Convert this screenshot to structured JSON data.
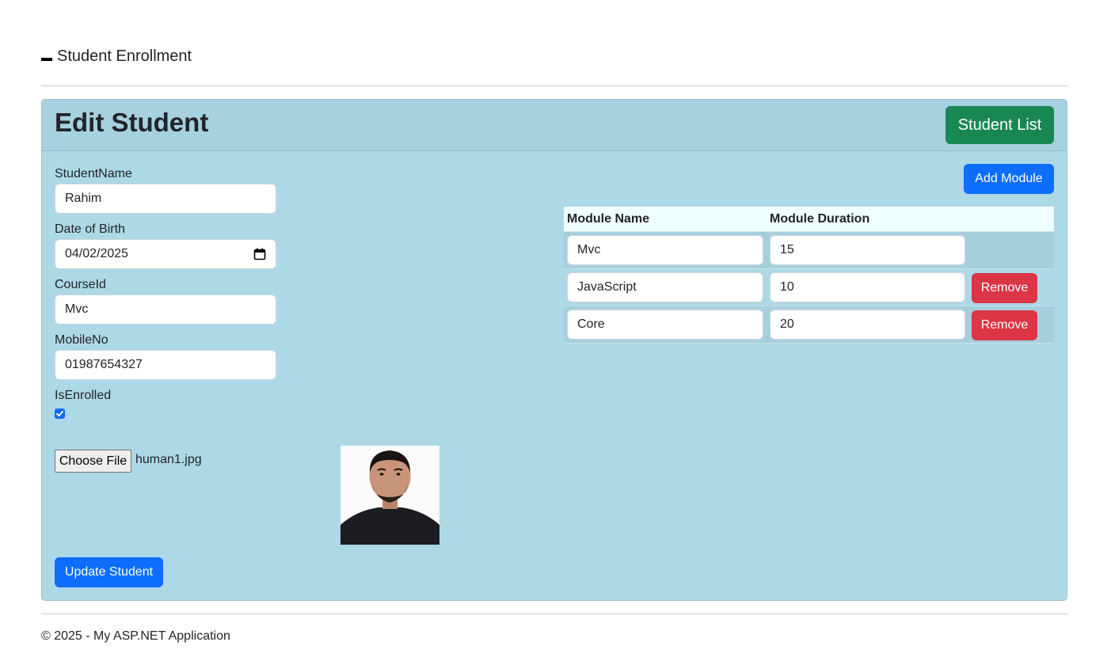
{
  "brand": {
    "title": "Student Enrollment"
  },
  "card": {
    "title": "Edit Student",
    "student_list_button": "Student List",
    "add_module_button": "Add Module",
    "update_button": "Update Student"
  },
  "form": {
    "student_name_label": "StudentName",
    "student_name_value": "Rahim",
    "dob_label": "Date of Birth",
    "dob_value": "04/02/2025",
    "course_label": "CourseId",
    "course_value": "Mvc",
    "mobile_label": "MobileNo",
    "mobile_value": "01987654327",
    "enrolled_label": "IsEnrolled",
    "enrolled_checked": true,
    "file_button": "Choose File",
    "file_name": "human1.jpg"
  },
  "modules": {
    "headers": [
      "Module Name",
      "Module Duration"
    ],
    "rows": [
      {
        "name": "Mvc",
        "duration": "15",
        "remove": ""
      },
      {
        "name": "JavaScript",
        "duration": "10",
        "remove": "Remove"
      },
      {
        "name": "Core",
        "duration": "20",
        "remove": "Remove"
      }
    ]
  },
  "footer": {
    "text": "© 2025 - My ASP.NET Application"
  },
  "colors": {
    "card_bg": "#add8e6",
    "success": "#198754",
    "primary": "#0d6efd",
    "danger": "#dc3545"
  }
}
